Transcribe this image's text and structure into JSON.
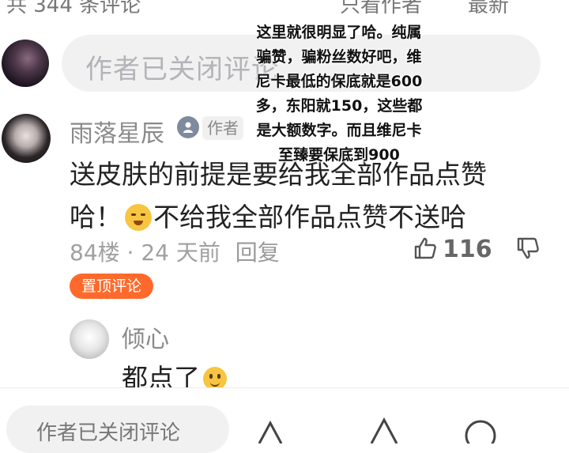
{
  "top": {
    "comment_count": "共 344 条评论",
    "filter_label": "只看作者",
    "sort_label": "最新"
  },
  "input": {
    "placeholder": "作者已关闭评论"
  },
  "comment": {
    "username": "雨落星辰",
    "author_tag": "作者",
    "line1": "送皮肤的前提是要给我全部作品点赞",
    "line2_start": "哈！",
    "line2_end": "不给我全部作品点赞不送哈",
    "floor": "84楼 · 24 天前",
    "reply_label": "回复",
    "like_count": "116",
    "pin_label": "置顶评论"
  },
  "reply": {
    "username": "倾心",
    "text": "都点了"
  },
  "bottom": {
    "placeholder": "作者已关闭评论"
  },
  "caption": {
    "text": "这里就很明显了哈。纯属骗赞，骗粉丝数好吧，维尼卡最低的保底就是600多，东阳就150，这些都是大额数字。而且维尼卡至臻要保底到900"
  },
  "colors": {
    "pin_badge": "#ff6a2c",
    "input_bg": "#f1f1f2"
  }
}
